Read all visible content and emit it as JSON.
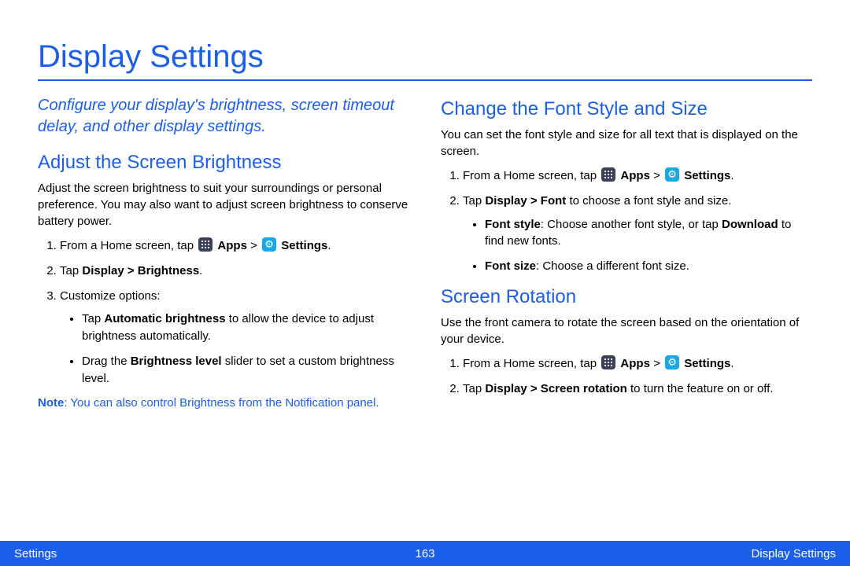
{
  "title": "Display Settings",
  "intro": "Configure your display's brightness, screen timeout delay, and other display settings.",
  "left": {
    "h2": "Adjust the Screen Brightness",
    "p1": "Adjust the screen brightness to suit your surroundings or personal preference. You may also want to adjust screen brightness to conserve battery power.",
    "step1_pre": "From a Home screen, tap ",
    "apps_label": "Apps",
    "gt": " > ",
    "settings_label": "Settings",
    "step1_post": ".",
    "step2_pre": "Tap ",
    "step2_bold": "Display > Brightness",
    "step2_post": ".",
    "step3": "Customize options:",
    "bullet1_pre": "Tap ",
    "bullet1_bold": "Automatic brightness",
    "bullet1_post": " to allow the device to adjust brightness automatically.",
    "bullet2_pre": "Drag the ",
    "bullet2_bold": "Brightness level",
    "bullet2_post": " slider to set a custom brightness level.",
    "note_label": "Note",
    "note_body": ": You can also control Brightness from the Notification panel."
  },
  "right": {
    "font_h2": "Change the Font Style and Size",
    "font_p1": "You can set the font style and size for all text that is displayed on the screen.",
    "font_step1_pre": "From a Home screen, tap ",
    "font_step1_post": ".",
    "font_step2_pre": "Tap ",
    "font_step2_bold": "Display > Font",
    "font_step2_post": " to choose a font style and size.",
    "font_b1_bold": "Font style",
    "font_b1_mid": ": Choose another font style, or tap ",
    "font_b1_bold2": "Download",
    "font_b1_post": " to find new fonts.",
    "font_b2_bold": "Font size",
    "font_b2_post": ": Choose a different font size.",
    "rot_h2": "Screen Rotation",
    "rot_p1": "Use the front camera to rotate the screen based on the orientation of your device.",
    "rot_step1_pre": "From a Home screen, tap ",
    "rot_step1_post": ".",
    "rot_step2_pre": "Tap ",
    "rot_step2_bold": "Display > Screen rotation",
    "rot_step2_post": " to turn the feature on or off."
  },
  "footer": {
    "left": "Settings",
    "center": "163",
    "right": "Display Settings"
  }
}
